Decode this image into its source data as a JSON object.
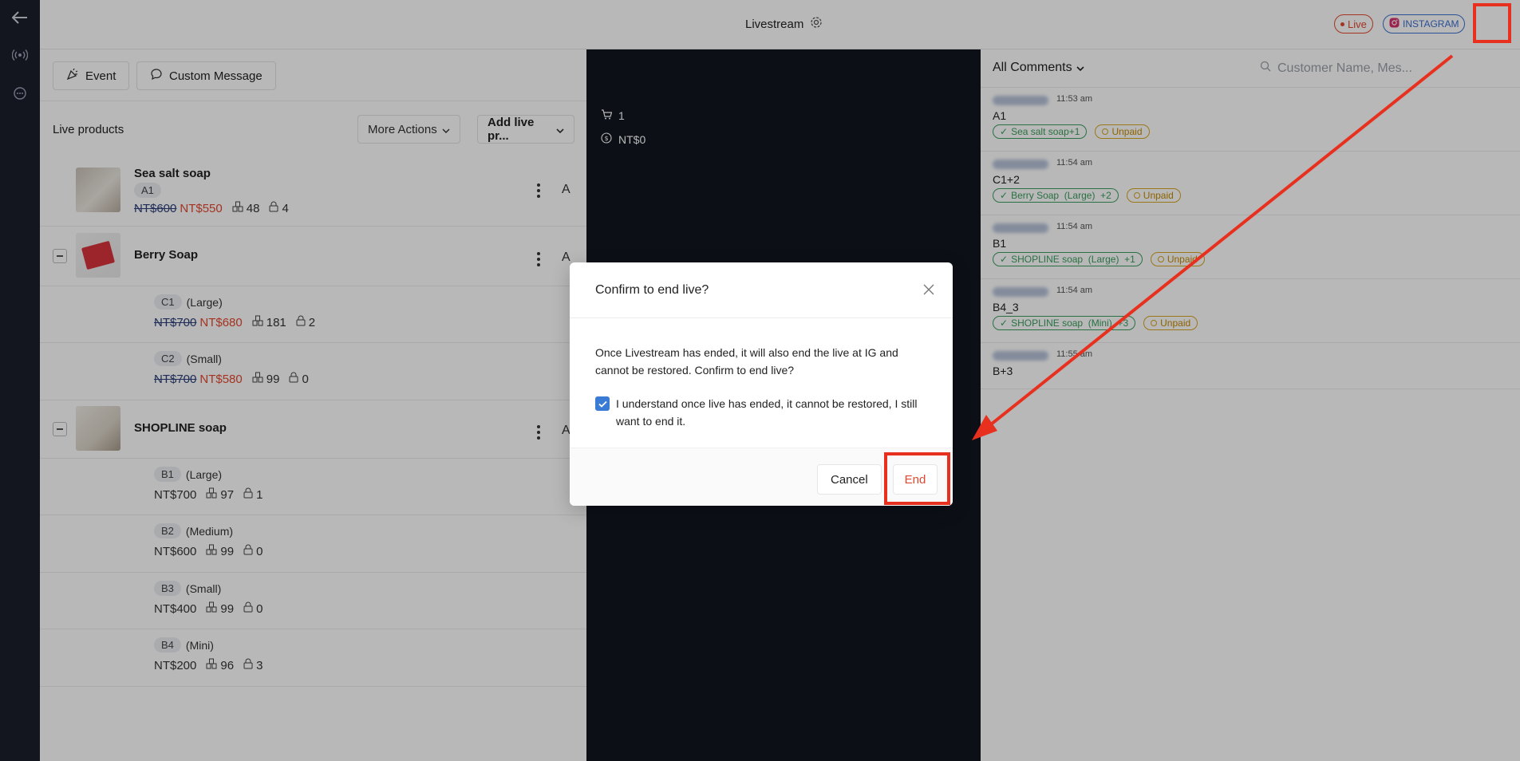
{
  "header": {
    "title": "Livestream",
    "live_badge": "Live",
    "platform_badge": "INSTAGRAM"
  },
  "toolbar": {
    "event_label": "Event",
    "custom_message_label": "Custom Message"
  },
  "products": {
    "section_label": "Live products",
    "more_actions_label": "More Actions",
    "add_live_label": "Add live pr...",
    "column_letter": "A",
    "items": [
      {
        "name": "Sea salt soap",
        "code": "A1",
        "original_price": "NT$600",
        "sale_price": "NT$550",
        "stock": "48",
        "locked": "4"
      },
      {
        "name": "Berry Soap",
        "variants": [
          {
            "code": "C1",
            "size": "(Large)",
            "original_price": "NT$700",
            "sale_price": "NT$680",
            "stock": "181",
            "locked": "2"
          },
          {
            "code": "C2",
            "size": "(Small)",
            "original_price": "NT$700",
            "sale_price": "NT$580",
            "stock": "99",
            "locked": "0"
          }
        ]
      },
      {
        "name": "SHOPLINE soap",
        "variants": [
          {
            "code": "B1",
            "size": "(Large)",
            "price": "NT$700",
            "stock": "97",
            "locked": "1"
          },
          {
            "code": "B2",
            "size": "(Medium)",
            "price": "NT$600",
            "stock": "99",
            "locked": "0"
          },
          {
            "code": "B3",
            "size": "(Small)",
            "price": "NT$400",
            "stock": "99",
            "locked": "0"
          },
          {
            "code": "B4",
            "size": "(Mini)",
            "price": "NT$200",
            "stock": "96",
            "locked": "3"
          }
        ]
      }
    ]
  },
  "stream_stats": {
    "cart_count": "1",
    "revenue": "NT$0"
  },
  "comments": {
    "filter_label": "All Comments",
    "search_placeholder": "Customer Name, Mes...",
    "items": [
      {
        "time": "11:53 am",
        "text": "A1",
        "tags": [
          "Sea salt soap+1"
        ],
        "status": "Unpaid"
      },
      {
        "time": "11:54 am",
        "text": "C1+2",
        "tags": [
          "Berry Soap  (Large)  +2"
        ],
        "status": "Unpaid"
      },
      {
        "time": "11:54 am",
        "text": "B1",
        "tags": [
          "SHOPLINE soap  (Large)  +1"
        ],
        "status": "Unpaid"
      },
      {
        "time": "11:54 am",
        "text": "B4_3",
        "tags": [
          "SHOPLINE soap  (Mini)  +3"
        ],
        "status": "Unpaid"
      },
      {
        "time": "11:55 am",
        "text": "B+3",
        "tags": [],
        "status": ""
      }
    ]
  },
  "modal": {
    "title": "Confirm to end live?",
    "body": "Once Livestream has ended, it will also end the live at IG and cannot be restored. Confirm to end live?",
    "checkbox_label": "I understand once live has ended, it cannot be restored, I still want to end it.",
    "checkbox_checked": true,
    "cancel_label": "Cancel",
    "end_label": "End"
  },
  "colors": {
    "accent_red": "#e3472f",
    "rail_bg": "#1b1f2b",
    "video_bg": "#121520",
    "annotation_red": "#e8301f",
    "checkbox_blue": "#3a7bd5"
  }
}
